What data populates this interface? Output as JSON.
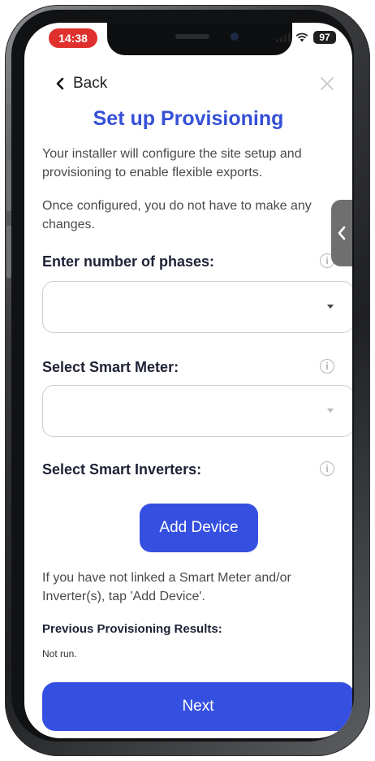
{
  "status_bar": {
    "time": "14:38",
    "battery": "97"
  },
  "nav": {
    "back_label": "Back"
  },
  "page": {
    "title": "Set up Provisioning",
    "intro_1": "Your installer will configure the site setup and provisioning to enable flexible exports.",
    "intro_2": "Once configured, you do not have to make any changes."
  },
  "phases": {
    "label": "Enter number of phases:",
    "value": ""
  },
  "smart_meter": {
    "label": "Select Smart Meter:",
    "value": ""
  },
  "smart_inverters": {
    "label": "Select Smart Inverters:",
    "add_button": "Add Device"
  },
  "hint": "If you have not linked a Smart Meter and/or Inverter(s), tap 'Add Device'.",
  "previous_results": {
    "label": "Previous Provisioning Results:",
    "value": "Not run."
  },
  "footer": {
    "next_label": "Next"
  },
  "colors": {
    "accent": "#3550e0",
    "title": "#3550d6",
    "time_pill": "#e0302d"
  }
}
